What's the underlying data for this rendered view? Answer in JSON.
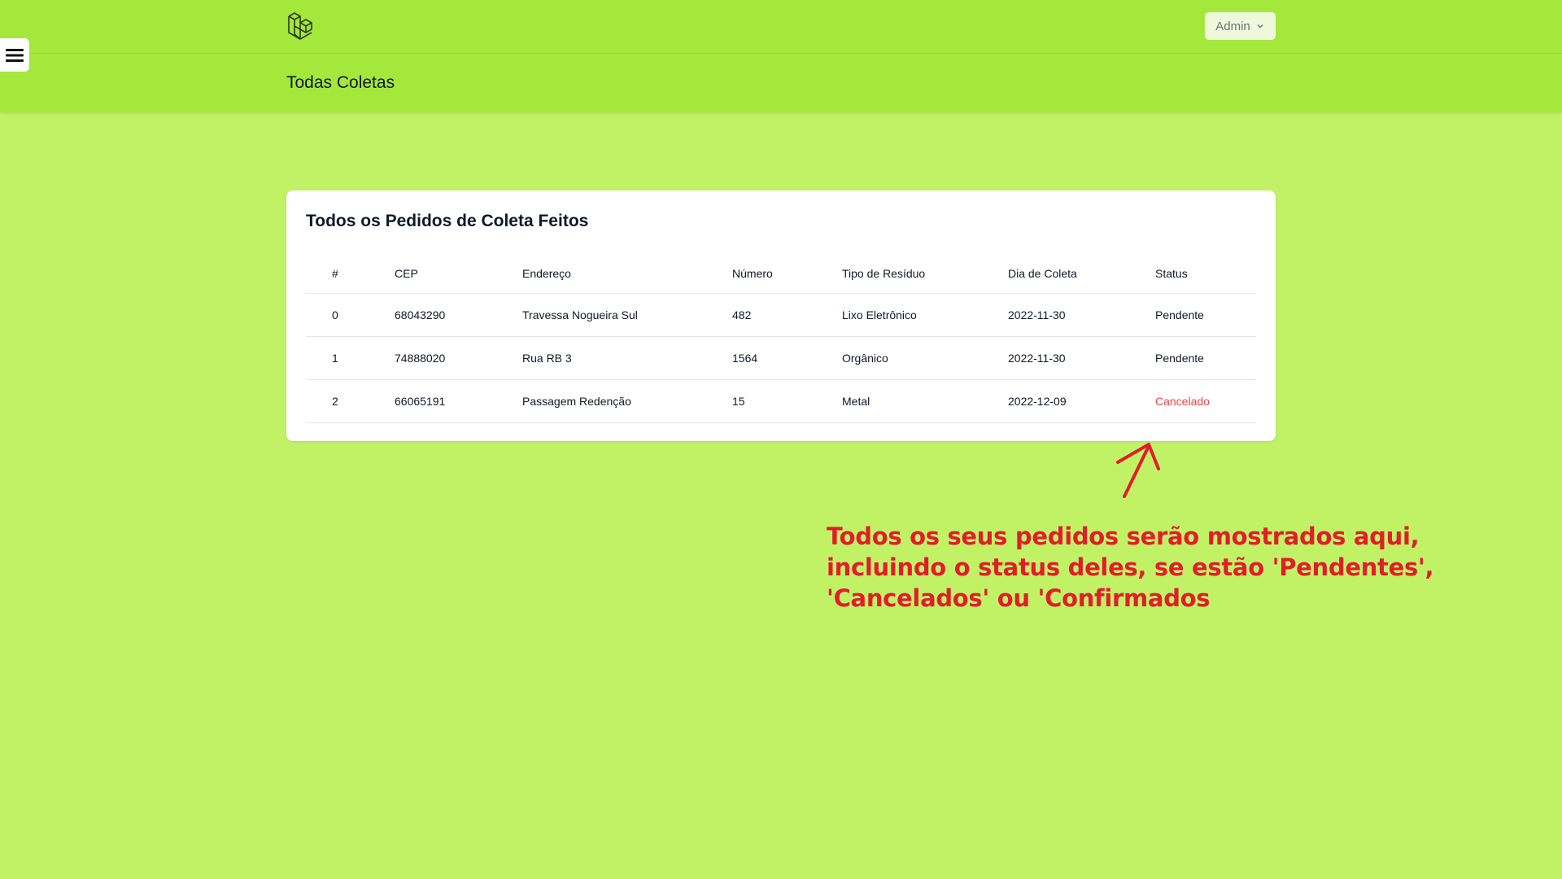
{
  "header": {
    "logo_icon": "laravel-logo-icon",
    "user_menu_label": "Admin",
    "page_title": "Todas Coletas",
    "menu_icon": "hamburger-menu-icon"
  },
  "card": {
    "title": "Todos os Pedidos de Coleta Feitos",
    "columns": [
      "#",
      "CEP",
      "Endereço",
      "Número",
      "Tipo de Resíduo",
      "Dia de Coleta",
      "Status"
    ],
    "rows": [
      [
        "0",
        "68043290",
        "Travessa Nogueira Sul",
        "482",
        "Lixo Eletrônico",
        "2022-11-30",
        "Pendente"
      ],
      [
        "1",
        "74888020",
        "Rua RB 3",
        "1564",
        "Orgânico",
        "2022-11-30",
        "Pendente"
      ],
      [
        "2",
        "66065191",
        "Passagem Redenção",
        "15",
        "Metal",
        "2022-12-09",
        "Cancelado"
      ]
    ]
  },
  "annotation": {
    "lines": [
      "Todos os seus pedidos serão mostrados aqui,",
      "incluindo o status deles, se estão 'Pendentes',",
      "'Cancelados' ou 'Confirmados"
    ],
    "color": "#e11d2a"
  },
  "colors": {
    "background": "#c1f266",
    "header": "#a3e83a",
    "status_cancelled": "#ef4444"
  }
}
